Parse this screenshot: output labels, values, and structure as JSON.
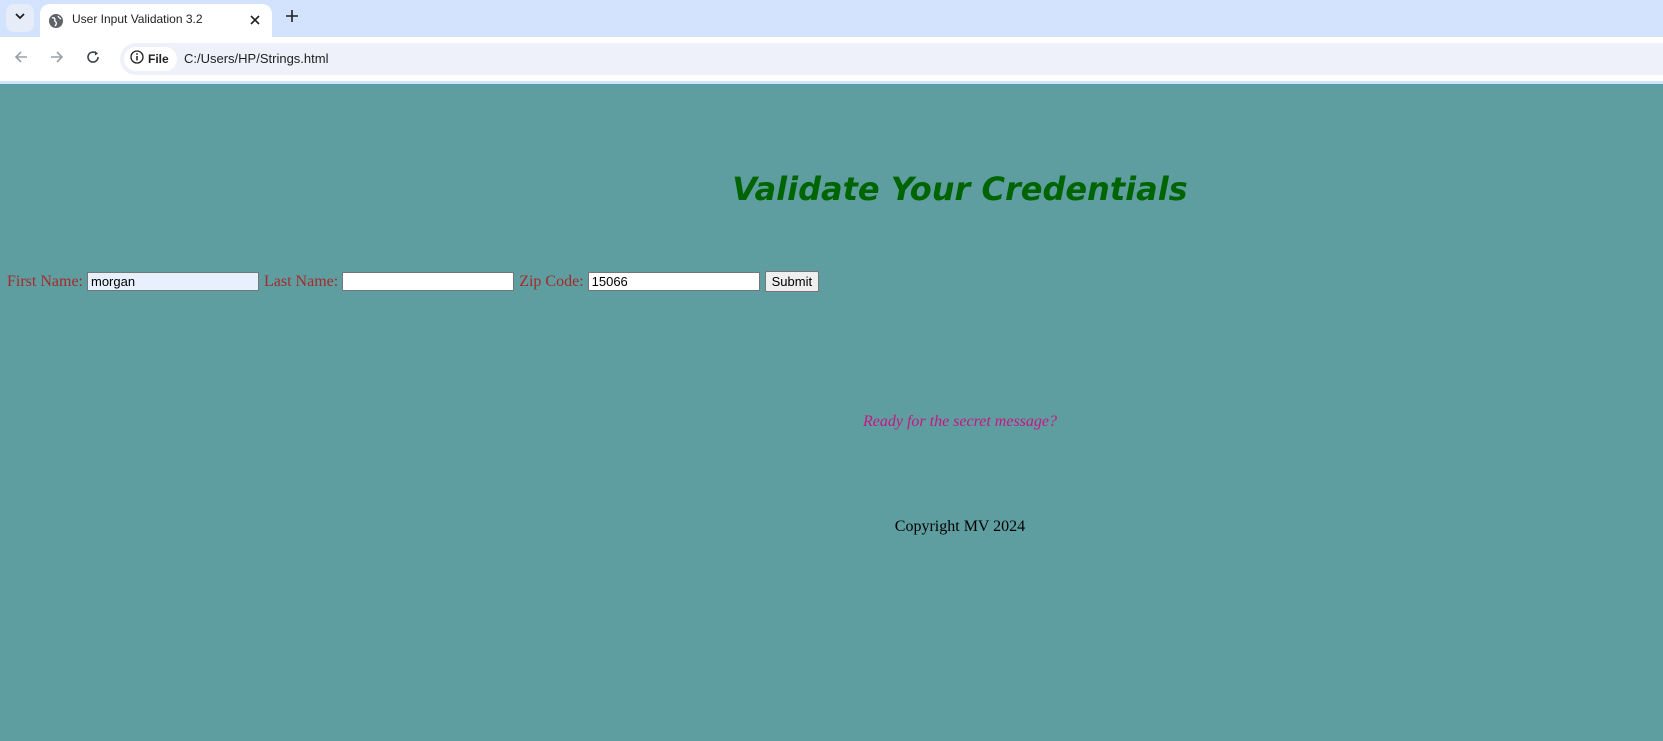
{
  "browser": {
    "tab": {
      "title": "User Input Validation 3.2"
    },
    "site_chip_label": "File",
    "url": "C:/Users/HP/Strings.html"
  },
  "page": {
    "background_color": "#5f9ea0",
    "title": "Validate Your Credentials",
    "form": {
      "first_name_label": "First Name:",
      "first_name_value": "morgan",
      "last_name_label": "Last Name:",
      "last_name_value": "",
      "zip_code_label": "Zip Code:",
      "zip_code_value": "15066",
      "submit_label": "Submit"
    },
    "secret_message": "Ready for the secret message?",
    "copyright": "Copyright MV 2024"
  },
  "colors": {
    "title": "#006400",
    "form_label": "#a52a2a",
    "secret_message": "#c71585",
    "copyright": "#000000"
  },
  "icons": {
    "tab_search": "chevron-down-icon",
    "favicon": "globe-icon",
    "tab_close": "close-icon",
    "new_tab": "plus-icon",
    "back": "arrow-left-icon",
    "forward": "arrow-right-icon",
    "reload": "reload-icon",
    "site_info": "info-icon"
  }
}
